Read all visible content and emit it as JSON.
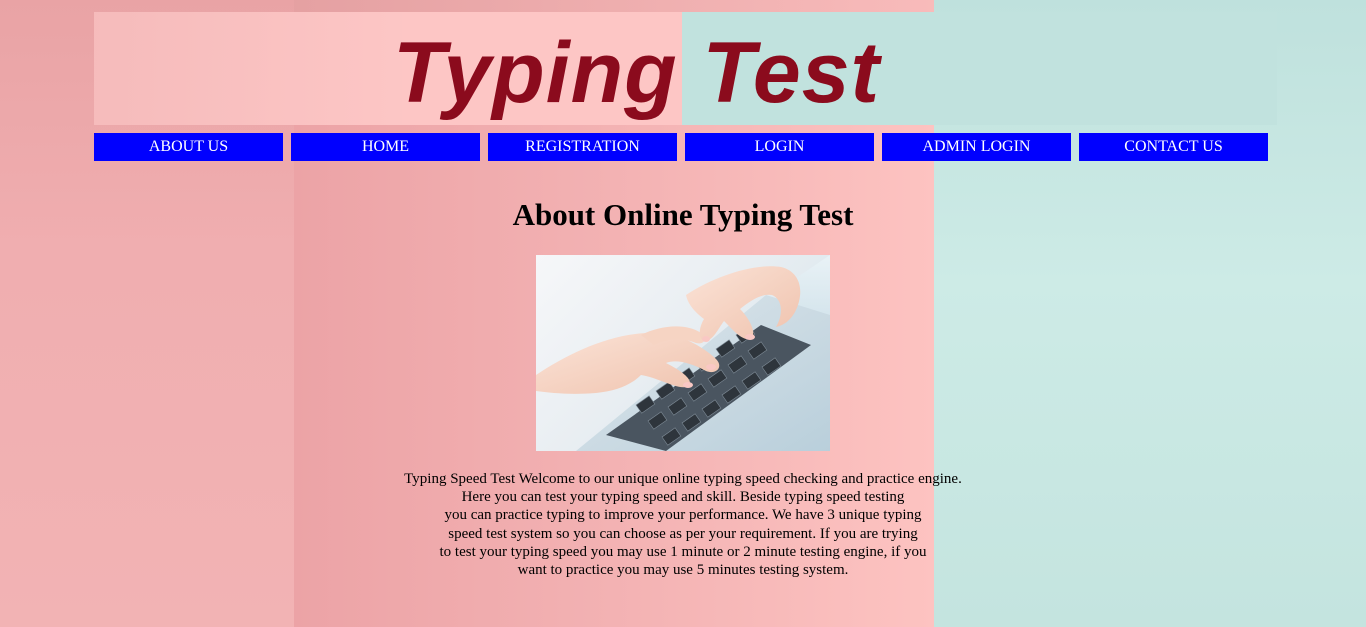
{
  "site": {
    "logo_text": "Typing Test"
  },
  "nav": {
    "items": [
      {
        "label": "ABOUT US"
      },
      {
        "label": "HOME"
      },
      {
        "label": "REGISTRATION"
      },
      {
        "label": "LOGIN"
      },
      {
        "label": "ADMIN LOGIN"
      },
      {
        "label": "CONTACT US"
      }
    ]
  },
  "main": {
    "title": "About Online Typing Test",
    "intro_lines": [
      "Typing Speed Test Welcome to our unique online typing speed checking and practice engine.",
      "Here you can test your typing speed and skill. Beside typing speed testing",
      "you can practice typing to improve your performance. We have 3 unique typing",
      "speed test system so you can choose as per your requirement. If you are trying",
      "to test your typing speed you may use 1 minute or 2 minute testing engine, if you",
      "want to practice you may use 5 minutes testing system."
    ]
  },
  "colors": {
    "nav_bg": "#0000ff",
    "nav_text": "#ffffff",
    "logo": "#8b0b1d",
    "bg_pink": "#f2b3b4",
    "bg_teal": "#c4e4df"
  },
  "icons": {
    "hero_image": "hands-typing-on-laptop-image"
  }
}
